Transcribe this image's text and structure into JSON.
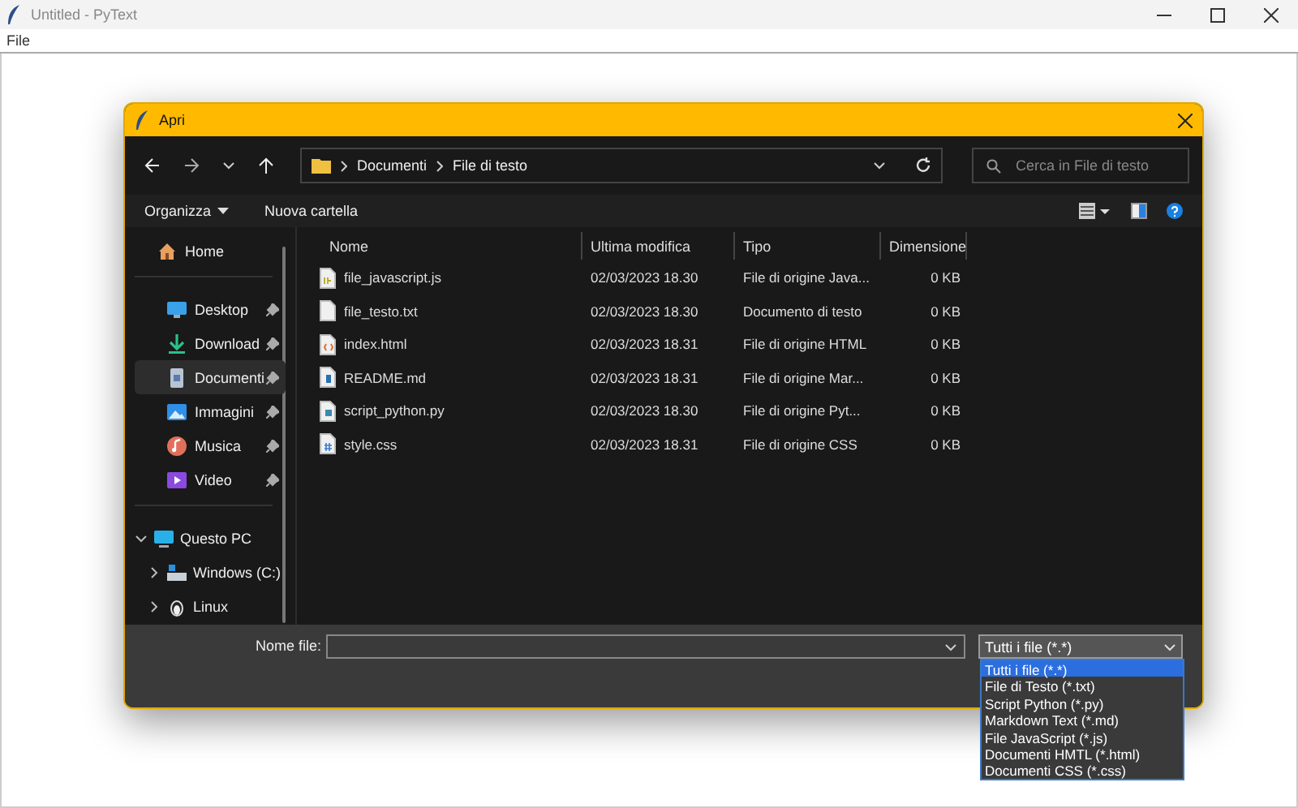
{
  "window": {
    "title": "Untitled - PyText"
  },
  "menu": [
    "File"
  ],
  "dialog": {
    "title": "Apri",
    "path": [
      "Documenti",
      "File di testo"
    ],
    "search": {
      "placeholder": "Cerca in File di testo"
    },
    "commands": {
      "organize": "Organizza",
      "new_folder": "Nuova cartella"
    },
    "sidebar": [
      {
        "items": [
          {
            "label": "Home",
            "kind": "home",
            "pinned": false,
            "selected": false
          }
        ]
      },
      {
        "items": [
          {
            "label": "Desktop",
            "kind": "desktop",
            "pinned": true,
            "selected": false
          },
          {
            "label": "Download",
            "kind": "download",
            "pinned": true,
            "selected": false
          },
          {
            "label": "Documenti",
            "kind": "documents",
            "pinned": true,
            "selected": true
          },
          {
            "label": "Immagini",
            "kind": "pictures",
            "pinned": true,
            "selected": false
          },
          {
            "label": "Musica",
            "kind": "music",
            "pinned": true,
            "selected": false
          },
          {
            "label": "Video",
            "kind": "video",
            "pinned": true,
            "selected": false
          }
        ]
      },
      {
        "items": [
          {
            "label": "Questo PC",
            "kind": "pc",
            "expanded": true,
            "selected": false,
            "children": [
              {
                "label": "Windows (C:)",
                "kind": "drive",
                "expanded": false,
                "selected": false
              },
              {
                "label": "Linux",
                "kind": "linux",
                "expanded": false,
                "selected": false
              }
            ]
          }
        ]
      }
    ],
    "columns": [
      "Nome",
      "Ultima modifica",
      "Tipo",
      "Dimensione"
    ],
    "rows": [
      {
        "name": "file_javascript.js",
        "kind": "js",
        "modified": "02/03/2023 18.30",
        "type": "File di origine Java...",
        "size": "0 KB"
      },
      {
        "name": "file_testo.txt",
        "kind": "txt",
        "modified": "02/03/2023 18.30",
        "type": "Documento di testo",
        "size": "0 KB"
      },
      {
        "name": "index.html",
        "kind": "html",
        "modified": "02/03/2023 18.31",
        "type": "File di origine HTML",
        "size": "0 KB"
      },
      {
        "name": "README.md",
        "kind": "md",
        "modified": "02/03/2023 18.31",
        "type": "File di origine Mar...",
        "size": "0 KB"
      },
      {
        "name": "script_python.py",
        "kind": "py",
        "modified": "02/03/2023 18.30",
        "type": "File di origine Pyt...",
        "size": "0 KB"
      },
      {
        "name": "style.css",
        "kind": "css",
        "modified": "02/03/2023 18.31",
        "type": "File di origine CSS",
        "size": "0 KB"
      }
    ],
    "filename": {
      "label": "Nome file:"
    },
    "filter": {
      "value": "Tutti i file (*.*)",
      "expanded": true,
      "options": [
        {
          "label": "Tutti i file (*.*)",
          "selected": true
        },
        {
          "label": "File di Testo (*.txt)",
          "selected": false
        },
        {
          "label": "Script Python (*.py)",
          "selected": false
        },
        {
          "label": "Markdown Text (*.md)",
          "selected": false
        },
        {
          "label": "File JavaScript (*.js)",
          "selected": false
        },
        {
          "label": "Documenti HMTL (*.html)",
          "selected": false
        },
        {
          "label": "Documenti CSS (*.css)",
          "selected": false
        }
      ]
    }
  }
}
